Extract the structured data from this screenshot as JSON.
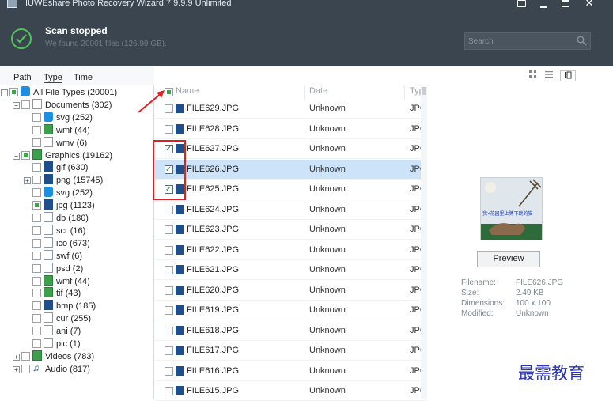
{
  "window": {
    "title": "IUWEshare Photo Recovery Wizard 7.9.9.9 Unlimited",
    "close_glyph": "✕"
  },
  "scan": {
    "status": "Scan stopped",
    "summary": "We found 20001 files (126.99 GB)."
  },
  "search": {
    "placeholder": "Search"
  },
  "tabs": [
    "Path",
    "Type",
    "Time"
  ],
  "view_buttons": [
    "thumbnail-view",
    "list-view",
    "detail-view"
  ],
  "tree": [
    {
      "label": "All File Types (20001)",
      "icon": "computer",
      "expander": "−",
      "check": "partial"
    },
    {
      "label": "Documents (302)",
      "icon": "folder",
      "expander": "−",
      "check": "none"
    },
    {
      "label": "svg (252)",
      "icon": "chrome",
      "check": "none"
    },
    {
      "label": "wmf (44)",
      "icon": "image",
      "check": "none"
    },
    {
      "label": "wmv (6)",
      "icon": "file",
      "check": "none"
    },
    {
      "label": "Graphics (19162)",
      "icon": "picture",
      "expander": "−",
      "check": "partial"
    },
    {
      "label": "gif (630)",
      "icon": "dark",
      "check": "none"
    },
    {
      "label": "png (15745)",
      "icon": "dark",
      "expander": "+",
      "check": "none"
    },
    {
      "label": "svg (252)",
      "icon": "chrome",
      "check": "none"
    },
    {
      "label": "jpg (1123)",
      "icon": "dark",
      "check": "partial"
    },
    {
      "label": "db (180)",
      "icon": "file",
      "check": "none"
    },
    {
      "label": "scr (16)",
      "icon": "file",
      "check": "none"
    },
    {
      "label": "ico (673)",
      "icon": "file",
      "check": "none"
    },
    {
      "label": "swf (6)",
      "icon": "file",
      "check": "none"
    },
    {
      "label": "psd (2)",
      "icon": "file",
      "check": "none"
    },
    {
      "label": "wmf (44)",
      "icon": "image",
      "check": "none"
    },
    {
      "label": "tif (43)",
      "icon": "image",
      "check": "none"
    },
    {
      "label": "bmp (185)",
      "icon": "dark",
      "check": "none"
    },
    {
      "label": "cur (255)",
      "icon": "file",
      "check": "none"
    },
    {
      "label": "ani (7)",
      "icon": "file",
      "check": "none"
    },
    {
      "label": "pic (1)",
      "icon": "file",
      "check": "none"
    },
    {
      "label": "Videos (783)",
      "icon": "video",
      "expander": "+",
      "check": "none"
    },
    {
      "label": "Audio (817)",
      "icon": "audio",
      "expander": "+",
      "check": "none"
    }
  ],
  "list": {
    "columns": {
      "name": "Name",
      "date": "Date",
      "type": "Typ"
    },
    "rows": [
      {
        "name": "FILE629.JPG",
        "date": "Unknown",
        "type": "JPG",
        "checked": false,
        "selected": false
      },
      {
        "name": "FILE628.JPG",
        "date": "Unknown",
        "type": "JPG",
        "checked": false,
        "selected": false
      },
      {
        "name": "FILE627.JPG",
        "date": "Unknown",
        "type": "JPG",
        "checked": true,
        "selected": false
      },
      {
        "name": "FILE626.JPG",
        "date": "Unknown",
        "type": "JPG",
        "checked": true,
        "selected": true
      },
      {
        "name": "FILE625.JPG",
        "date": "Unknown",
        "type": "JPG",
        "checked": true,
        "selected": false
      },
      {
        "name": "FILE624.JPG",
        "date": "Unknown",
        "type": "JPG",
        "checked": false,
        "selected": false
      },
      {
        "name": "FILE623.JPG",
        "date": "Unknown",
        "type": "JPG",
        "checked": false,
        "selected": false
      },
      {
        "name": "FILE622.JPG",
        "date": "Unknown",
        "type": "JPG",
        "checked": false,
        "selected": false
      },
      {
        "name": "FILE621.JPG",
        "date": "Unknown",
        "type": "JPG",
        "checked": false,
        "selected": false
      },
      {
        "name": "FILE620.JPG",
        "date": "Unknown",
        "type": "JPG",
        "checked": false,
        "selected": false
      },
      {
        "name": "FILE619.JPG",
        "date": "Unknown",
        "type": "JPG",
        "checked": false,
        "selected": false
      },
      {
        "name": "FILE618.JPG",
        "date": "Unknown",
        "type": "JPG",
        "checked": false,
        "selected": false
      },
      {
        "name": "FILE617.JPG",
        "date": "Unknown",
        "type": "JPG",
        "checked": false,
        "selected": false
      },
      {
        "name": "FILE616.JPG",
        "date": "Unknown",
        "type": "JPG",
        "checked": false,
        "selected": false
      },
      {
        "name": "FILE615.JPG",
        "date": "Unknown",
        "type": "JPG",
        "checked": false,
        "selected": false
      }
    ]
  },
  "preview": {
    "button": "Preview",
    "image_caption": "我×花园里上膊下跳的猫",
    "meta": [
      {
        "label": "Filename:",
        "value": "FILE626.JPG"
      },
      {
        "label": "Size:",
        "value": "2.49 KB"
      },
      {
        "label": "Dimensions:",
        "value": "100 x 100"
      },
      {
        "label": "Modified:",
        "value": "Unknown"
      }
    ]
  },
  "watermark": "最需教育",
  "colors": {
    "header_bg": "#3b4550",
    "check_green": "#4fc25a",
    "annotation_red": "#e02020",
    "selection": "#cde3f9",
    "watermark": "#2a34b4"
  }
}
